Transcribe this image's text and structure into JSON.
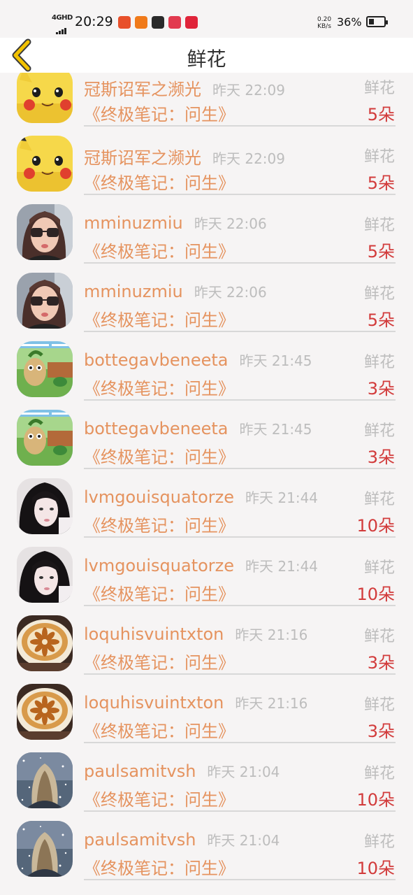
{
  "status_bar": {
    "network": "4GHD",
    "time": "20:29",
    "speed_value": "0.20",
    "speed_unit": "KB/s",
    "battery": "36%",
    "battery_level": 0.36,
    "app_icons": [
      "app-icon-1",
      "app-icon-2",
      "app-icon-3",
      "app-icon-4",
      "app-icon-5"
    ]
  },
  "header": {
    "title": "鲜花",
    "back_icon": "chevron-left-icon"
  },
  "colors": {
    "accent": "#e5935f",
    "count": "#d23b3b",
    "back": "#f2c200"
  },
  "records": [
    {
      "user": "冠斯诏军之濒光",
      "time": "昨天 22:09",
      "type": "鲜花",
      "book": "《终极笔记：问生》",
      "count": "5朵",
      "avatar": "pikachu"
    },
    {
      "user": "冠斯诏军之濒光",
      "time": "昨天 22:09",
      "type": "鲜花",
      "book": "《终极笔记：问生》",
      "count": "5朵",
      "avatar": "pikachu"
    },
    {
      "user": "mminuzmiu",
      "time": "昨天 22:06",
      "type": "鲜花",
      "book": "《终极笔记：问生》",
      "count": "5朵",
      "avatar": "girl-glasses"
    },
    {
      "user": "mminuzmiu",
      "time": "昨天 22:06",
      "type": "鲜花",
      "book": "《终极笔记：问生》",
      "count": "5朵",
      "avatar": "girl-glasses"
    },
    {
      "user": "bottegavbeneeta",
      "time": "昨天 21:45",
      "type": "鲜花",
      "book": "《终极笔记：问生》",
      "count": "3朵",
      "avatar": "cartoon"
    },
    {
      "user": "bottegavbeneeta",
      "time": "昨天 21:45",
      "type": "鲜花",
      "book": "《终极笔记：问生》",
      "count": "3朵",
      "avatar": "cartoon"
    },
    {
      "user": "lvmgouisquatorze",
      "time": "昨天 21:44",
      "type": "鲜花",
      "book": "《终极笔记：问生》",
      "count": "10朵",
      "avatar": "girl-dark"
    },
    {
      "user": "lvmgouisquatorze",
      "time": "昨天 21:44",
      "type": "鲜花",
      "book": "《终极笔记：问生》",
      "count": "10朵",
      "avatar": "girl-dark"
    },
    {
      "user": "loquhisvuintxton",
      "time": "昨天 21:16",
      "type": "鲜花",
      "book": "《终极笔记：问生》",
      "count": "3朵",
      "avatar": "coffee"
    },
    {
      "user": "loquhisvuintxton",
      "time": "昨天 21:16",
      "type": "鲜花",
      "book": "《终极笔记：问生》",
      "count": "3朵",
      "avatar": "coffee"
    },
    {
      "user": "paulsamitvsh",
      "time": "昨天 21:04",
      "type": "鲜花",
      "book": "《终极笔记：问生》",
      "count": "10朵",
      "avatar": "snow-girl"
    },
    {
      "user": "paulsamitvsh",
      "time": "昨天 21:04",
      "type": "鲜花",
      "book": "《终极笔记：问生》",
      "count": "10朵",
      "avatar": "snow-girl"
    }
  ]
}
